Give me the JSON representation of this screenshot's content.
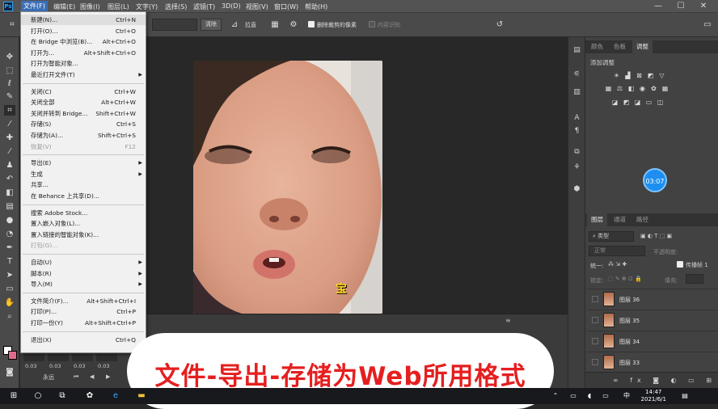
{
  "app": {
    "logo": "Ps"
  },
  "menubar": [
    "文件(F)",
    "编辑(E)",
    "图像(I)",
    "图层(L)",
    "文字(Y)",
    "选择(S)",
    "滤镜(T)",
    "3D(D)",
    "视图(V)",
    "窗口(W)",
    "帮助(H)"
  ],
  "window_controls": {
    "minimize": "—",
    "maximize": "☐",
    "close": "✕"
  },
  "options": {
    "clear_label": "清除",
    "straighten_label": "拉直",
    "delete_cropped_label": "删除裁剪的像素",
    "content_aware_label": "内容识别"
  },
  "file_menu": {
    "items": [
      {
        "label": "新建(N)...",
        "shortcut": "Ctrl+N"
      },
      {
        "label": "打开(O)...",
        "shortcut": "Ctrl+O"
      },
      {
        "label": "在 Bridge 中浏览(B)...",
        "shortcut": "Alt+Ctrl+O"
      },
      {
        "label": "打开为...",
        "shortcut": "Alt+Shift+Ctrl+O"
      },
      {
        "label": "打开为智能对象...",
        "shortcut": ""
      },
      {
        "label": "最近打开文件(T)",
        "shortcut": "",
        "submenu": true
      },
      {
        "label": "关闭(C)",
        "shortcut": "Ctrl+W"
      },
      {
        "label": "关闭全部",
        "shortcut": "Alt+Ctrl+W"
      },
      {
        "label": "关闭并转到 Bridge...",
        "shortcut": "Shift+Ctrl+W"
      },
      {
        "label": "存储(S)",
        "shortcut": "Ctrl+S"
      },
      {
        "label": "存储为(A)...",
        "shortcut": "Shift+Ctrl+S"
      },
      {
        "label": "恢复(V)",
        "shortcut": "F12",
        "disabled": true
      },
      {
        "label": "导出(E)",
        "shortcut": "",
        "submenu": true
      },
      {
        "label": "生成",
        "shortcut": "",
        "submenu": true
      },
      {
        "label": "共享...",
        "shortcut": ""
      },
      {
        "label": "在 Behance 上共享(D)...",
        "shortcut": ""
      },
      {
        "label": "搜索 Adobe Stock...",
        "shortcut": ""
      },
      {
        "label": "置入嵌入对象(L)...",
        "shortcut": ""
      },
      {
        "label": "置入链接的智能对象(K)...",
        "shortcut": ""
      },
      {
        "label": "打包(G)...",
        "shortcut": "",
        "disabled": true
      },
      {
        "label": "自动(U)",
        "shortcut": "",
        "submenu": true
      },
      {
        "label": "脚本(R)",
        "shortcut": "",
        "submenu": true
      },
      {
        "label": "导入(M)",
        "shortcut": "",
        "submenu": true
      },
      {
        "label": "文件简介(F)...",
        "shortcut": "Alt+Shift+Ctrl+I"
      },
      {
        "label": "打印(P)...",
        "shortcut": "Ctrl+P"
      },
      {
        "label": "打印一份(Y)",
        "shortcut": "Alt+Shift+Ctrl+P"
      },
      {
        "label": "退出(X)",
        "shortcut": "Ctrl+Q"
      }
    ]
  },
  "right_panel": {
    "top_tabs": [
      "颜色",
      "色板",
      "调整"
    ],
    "adjust_title": "添加调整",
    "timer": "03:07",
    "layers_tabs": [
      "图层",
      "通道",
      "路径"
    ],
    "filter_kind": "类型",
    "blend_mode": "正常",
    "opacity_label": "不透明度:",
    "unify_label": "统一:",
    "propagate_label": "传播帧 1",
    "lock_label": "锁定:",
    "fill_label": "填充:",
    "layers": [
      "图层 36",
      "图层 35",
      "图层 34",
      "图层 33"
    ]
  },
  "timeline": {
    "frame_times": [
      "0.03",
      "0.03",
      "0.03",
      "0.03"
    ],
    "loop": "永远"
  },
  "canvas": {
    "caption_char": "宝"
  },
  "banner": {
    "text": "文件-导出-存储为Web所用格式"
  },
  "taskbar": {
    "ime": "中",
    "time": "14:47",
    "date": "2021/6/1"
  }
}
